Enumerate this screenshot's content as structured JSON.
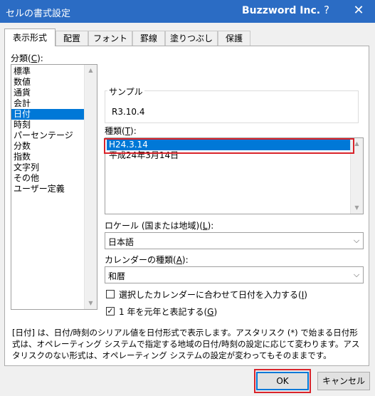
{
  "window": {
    "title": "セルの書式設定",
    "brand": "Buzzword Inc.",
    "help_label": "?",
    "close_label": "✕"
  },
  "tabs": [
    {
      "label": "表示形式",
      "active": true
    },
    {
      "label": "配置"
    },
    {
      "label": "フォント"
    },
    {
      "label": "罫線"
    },
    {
      "label": "塗りつぶし"
    },
    {
      "label": "保護"
    }
  ],
  "category": {
    "label": "分類",
    "accel": "C",
    "items": [
      "標準",
      "数値",
      "通貨",
      "会計",
      "日付",
      "時刻",
      "パーセンテージ",
      "分数",
      "指数",
      "文字列",
      "その他",
      "ユーザー定義"
    ],
    "selected": "日付"
  },
  "sample": {
    "label": "サンプル",
    "value": "R3.10.4"
  },
  "type": {
    "label": "種類",
    "accel": "T",
    "items": [
      "H24.3.14",
      "平成24年3月14日"
    ],
    "selected": "H24.3.14"
  },
  "locale": {
    "label": "ロケール (国または地域)",
    "accel": "L",
    "value": "日本語"
  },
  "calendar": {
    "label": "カレンダーの種類",
    "accel": "A",
    "value": "和暦"
  },
  "checkboxes": [
    {
      "label": "選択したカレンダーに合わせて日付を入力する",
      "accel": "I",
      "checked": false
    },
    {
      "label": "1 年を元年と表記する",
      "accel": "G",
      "checked": true
    }
  ],
  "description": "[日付] は、日付/時刻のシリアル値を日付形式で表示します。アスタリスク (*) で始まる日付形式は、オペレーティング システムで指定する地域の日付/時刻の設定に応じて変わります。アスタリスクのない形式は、オペレーティング システムの設定が変わってもそのままです。",
  "buttons": {
    "ok": "OK",
    "cancel": "キャンセル"
  },
  "scroll": {
    "up": "▲",
    "down": "▼",
    "dropdown": "⌵"
  },
  "check_mark": "✓",
  "colors": {
    "titlebar": "#2b6cc4",
    "selection": "#0078d7",
    "highlight": "#d9232a"
  }
}
